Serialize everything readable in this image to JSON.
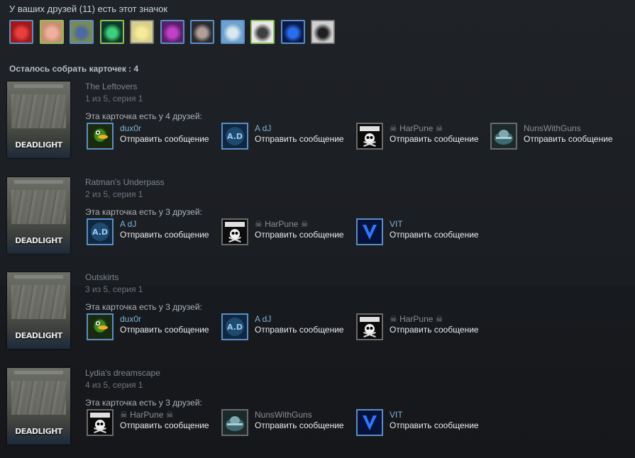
{
  "header": {
    "friends_title": "У ваших друзей (11) есть этот значок"
  },
  "friend_avatars": [
    {
      "name": "friend-avatar-1",
      "status": "online-blue",
      "bg": "#a01818",
      "fg": "#e84040"
    },
    {
      "name": "friend-avatar-2",
      "status": "online",
      "bg": "#c7906e",
      "fg": "#f0b0a0"
    },
    {
      "name": "friend-avatar-3",
      "status": "online-blue",
      "bg": "#7a8a55",
      "fg": "#4a6aa0"
    },
    {
      "name": "friend-avatar-4",
      "status": "online",
      "bg": "#0b3a2a",
      "fg": "#3ecf7a"
    },
    {
      "name": "friend-avatar-5",
      "status": "offline",
      "bg": "#d8cf8a",
      "fg": "#f4ec9a"
    },
    {
      "name": "friend-avatar-6",
      "status": "online-blue",
      "bg": "#5a1f6a",
      "fg": "#c040c8"
    },
    {
      "name": "friend-avatar-7",
      "status": "online-blue",
      "bg": "#2a2a30",
      "fg": "#b0a098"
    },
    {
      "name": "friend-avatar-8",
      "status": "online-blue",
      "bg": "#6ea2cf",
      "fg": "#d8e8f0"
    },
    {
      "name": "friend-avatar-9",
      "status": "online",
      "bg": "#e8e8e8",
      "fg": "#404040"
    },
    {
      "name": "friend-avatar-10",
      "status": "online-blue",
      "bg": "#0a1a4a",
      "fg": "#2a6ef0"
    },
    {
      "name": "friend-avatar-11",
      "status": "offline",
      "bg": "#d0d0d0",
      "fg": "#202020"
    }
  ],
  "remaining": "Осталось собрать карточек : 4",
  "colors": {
    "online_border": "#8dbf5a",
    "ingame_border": "#5b8ec3",
    "offline_border": "#7c7c7c",
    "name_online": "#7fb1d6"
  },
  "card_art_text": "DEADLIGHT",
  "cards": [
    {
      "title": "The Leftovers",
      "series": "1 из 5, серия 1",
      "have_text": "Эта карточка есть у 4 друзей:",
      "owners": [
        {
          "name": "dux0r",
          "msg": "Отправить сообщение",
          "status": "online",
          "icon": "duck-icon"
        },
        {
          "name": "A dJ",
          "msg": "Отправить сообщение",
          "status": "online",
          "icon": "adj-logo-icon"
        },
        {
          "name": "☠ HarPune ☠",
          "msg": "Отправить сообщение",
          "status": "offline",
          "icon": "skull-icon"
        },
        {
          "name": "NunsWithGuns",
          "msg": "Отправить сообщение",
          "status": "offline",
          "icon": "soldier-icon"
        }
      ]
    },
    {
      "title": "Ratman's Underpass",
      "series": "2 из 5, серия 1",
      "have_text": "Эта карточка есть у 3 друзей:",
      "owners": [
        {
          "name": "A dJ",
          "msg": "Отправить сообщение",
          "status": "online",
          "icon": "adj-logo-icon"
        },
        {
          "name": "☠ HarPune ☠",
          "msg": "Отправить сообщение",
          "status": "offline",
          "icon": "skull-icon"
        },
        {
          "name": "VIT",
          "msg": "Отправить сообщение",
          "status": "online",
          "icon": "v-logo-icon"
        }
      ]
    },
    {
      "title": "Outskirts",
      "series": "3 из 5, серия 1",
      "have_text": "Эта карточка есть у 3 друзей:",
      "owners": [
        {
          "name": "dux0r",
          "msg": "Отправить сообщение",
          "status": "online",
          "icon": "duck-icon"
        },
        {
          "name": "A dJ",
          "msg": "Отправить сообщение",
          "status": "online",
          "icon": "adj-logo-icon"
        },
        {
          "name": "☠ HarPune ☠",
          "msg": "Отправить сообщение",
          "status": "offline",
          "icon": "skull-icon"
        }
      ]
    },
    {
      "title": "Lydia's dreamscape",
      "series": "4 из 5, серия 1",
      "have_text": "Эта карточка есть у 3 друзей:",
      "owners": [
        {
          "name": "☠ HarPune ☠",
          "msg": "Отправить сообщение",
          "status": "offline",
          "icon": "skull-icon"
        },
        {
          "name": "NunsWithGuns",
          "msg": "Отправить сообщение",
          "status": "offline",
          "icon": "soldier-icon"
        },
        {
          "name": "VIT",
          "msg": "Отправить сообщение",
          "status": "online",
          "icon": "v-logo-icon"
        }
      ]
    }
  ]
}
